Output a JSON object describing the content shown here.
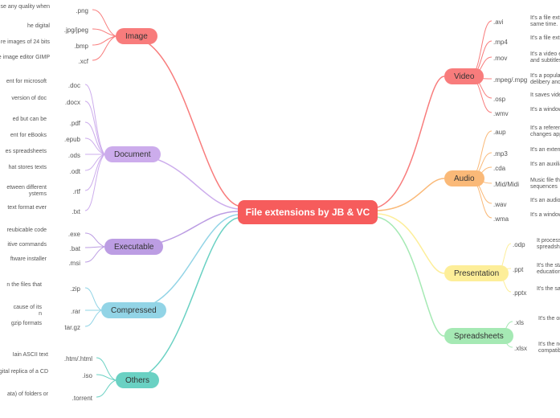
{
  "center": "File extensions by JB & VC",
  "right": {
    "video": {
      "label": "Video",
      "color": "#f87c7c",
      "items": [
        {
          "ext": ".avi",
          "desc": "It's a file extension to s\nsame time."
        },
        {
          "ext": ".mp4",
          "desc": "It's a file extension th"
        },
        {
          "ext": ".mov",
          "desc": "It's a video extension\nand subtitles"
        },
        {
          "ext": ".mpeg/.mpg",
          "desc": "It's a popular\ndelibery and p"
        },
        {
          "ext": ".osp",
          "desc": "It saves video editing"
        },
        {
          "ext": ".wmv",
          "desc": "It's a windows compr"
        }
      ]
    },
    "audio": {
      "label": "Audio",
      "color": "#fab978",
      "items": [
        {
          "ext": ".aup",
          "desc": "It's a reference to var\nchanges applied"
        },
        {
          "ext": ".mp3",
          "desc": "It's an extension for a"
        },
        {
          "ext": ".cda",
          "desc": "It's an auxiliary file to"
        },
        {
          "ext": ".Mid/Midi",
          "desc": "Music file that tr\nsequences"
        },
        {
          "ext": ".wav",
          "desc": "It's an audio file that"
        },
        {
          "ext": ".wma",
          "desc": "It's a windows compr"
        }
      ]
    },
    "presentation": {
      "label": "Presentation",
      "color": "#fdee99",
      "items": [
        {
          "ext": ".odp",
          "desc": "It processes\nspreadsheets"
        },
        {
          "ext": ".ppt",
          "desc": "It's the stand\neducation"
        },
        {
          "ext": ".pptx",
          "desc": "It's the same"
        }
      ]
    },
    "spreadsheets": {
      "label": "Spreadsheets",
      "color": "#a5e9b4",
      "items": [
        {
          "ext": ".xls",
          "desc": "It's the origi"
        },
        {
          "ext": ".xlsx",
          "desc": "It's the new\ncompatible"
        }
      ]
    }
  },
  "left": {
    "image": {
      "label": "Image",
      "color": "#f87c7c",
      "items": [
        {
          "ext": ".png",
          "desc": "se any quality when"
        },
        {
          "ext": ".jpg/jpeg",
          "desc": "he digital"
        },
        {
          "ext": ".bmp",
          "desc": "re images of 24 bits"
        },
        {
          "ext": ".xcf",
          "desc": "e image editor GIMP"
        }
      ]
    },
    "document": {
      "label": "Document",
      "color": "#ccacec",
      "items": [
        {
          "ext": ".doc",
          "desc": "ent for microsoft"
        },
        {
          "ext": ".docx",
          "desc": "version of doc"
        },
        {
          "ext": ".pdf",
          "desc": "ed but can be"
        },
        {
          "ext": ".epub",
          "desc": "ent for eBooks"
        },
        {
          "ext": ".ods",
          "desc": "es spreadsheets"
        },
        {
          "ext": ".odt",
          "desc": "hat stores texts"
        },
        {
          "ext": ".rtf",
          "desc": "etween different\nystems"
        },
        {
          "ext": ".txt",
          "desc": "text format ever"
        }
      ]
    },
    "executable": {
      "label": "Executable",
      "color": "#bc9de3",
      "items": [
        {
          "ext": ".exe",
          "desc": "reubicable code"
        },
        {
          "ext": ".bat",
          "desc": "itive commands"
        },
        {
          "ext": ".msi",
          "desc": "ftware installer"
        }
      ]
    },
    "compressed": {
      "label": "Compressed",
      "color": "#92d4e6",
      "items": [
        {
          "ext": ".zip",
          "desc": "n the files that"
        },
        {
          "ext": ".rar",
          "desc": "cause of its\nn"
        },
        {
          "ext": "tar.gz",
          "desc": "gzip formats"
        }
      ]
    },
    "others": {
      "label": "Others",
      "color": "#6ad1c3",
      "items": [
        {
          "ext": ".htm/.html",
          "desc": "Iain ASCII text"
        },
        {
          "ext": ".iso",
          "desc": "digital replica of a CD"
        },
        {
          "ext": ".torrent",
          "desc": "ata) of folders or"
        }
      ]
    }
  }
}
